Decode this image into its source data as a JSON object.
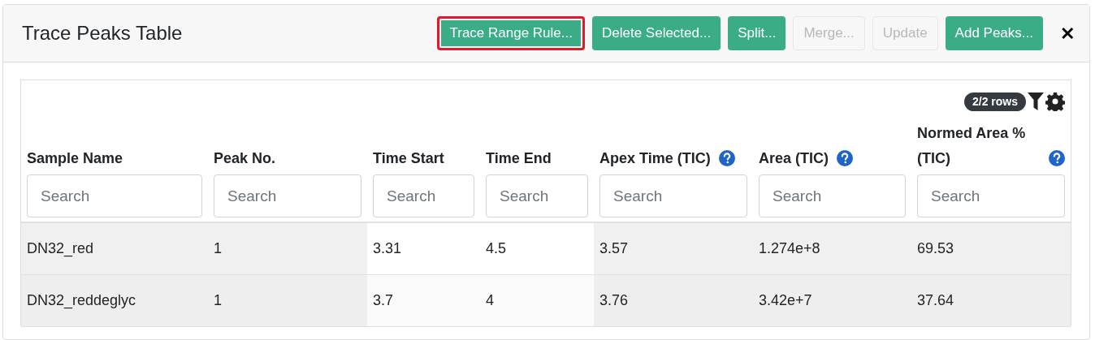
{
  "header": {
    "title": "Trace Peaks Table",
    "buttons": [
      {
        "label": "Trace Range Rule...",
        "disabled": false,
        "highlighted": true
      },
      {
        "label": "Delete Selected...",
        "disabled": false,
        "highlighted": false
      },
      {
        "label": "Split...",
        "disabled": false,
        "highlighted": false
      },
      {
        "label": "Merge...",
        "disabled": true,
        "highlighted": false
      },
      {
        "label": "Update",
        "disabled": true,
        "highlighted": false
      },
      {
        "label": "Add Peaks...",
        "disabled": false,
        "highlighted": false
      }
    ],
    "close": "✕"
  },
  "table": {
    "row_count": "2/2 rows",
    "columns": [
      {
        "label": "Sample Name",
        "help": false,
        "placeholder": "Search",
        "shaded": true
      },
      {
        "label": "Peak No.",
        "help": false,
        "placeholder": "Search",
        "shaded": true
      },
      {
        "label": "Time Start",
        "help": false,
        "placeholder": "Search",
        "shaded": false
      },
      {
        "label": "Time End",
        "help": false,
        "placeholder": "Search",
        "shaded": false
      },
      {
        "label": "Apex Time (TIC)",
        "help": true,
        "placeholder": "Search",
        "shaded": true
      },
      {
        "label": "Area (TIC)",
        "help": true,
        "placeholder": "Search",
        "shaded": true
      },
      {
        "label": "Normed Area % (TIC)",
        "help": true,
        "placeholder": "Search",
        "shaded": true
      }
    ],
    "rows": [
      [
        "DN32_red",
        "1",
        "3.31",
        "4.5",
        "3.57",
        "1.274e+8",
        "69.53"
      ],
      [
        "DN32_reddeglyc",
        "1",
        "3.7",
        "4",
        "3.76",
        "3.42e+7",
        "37.64"
      ]
    ]
  }
}
